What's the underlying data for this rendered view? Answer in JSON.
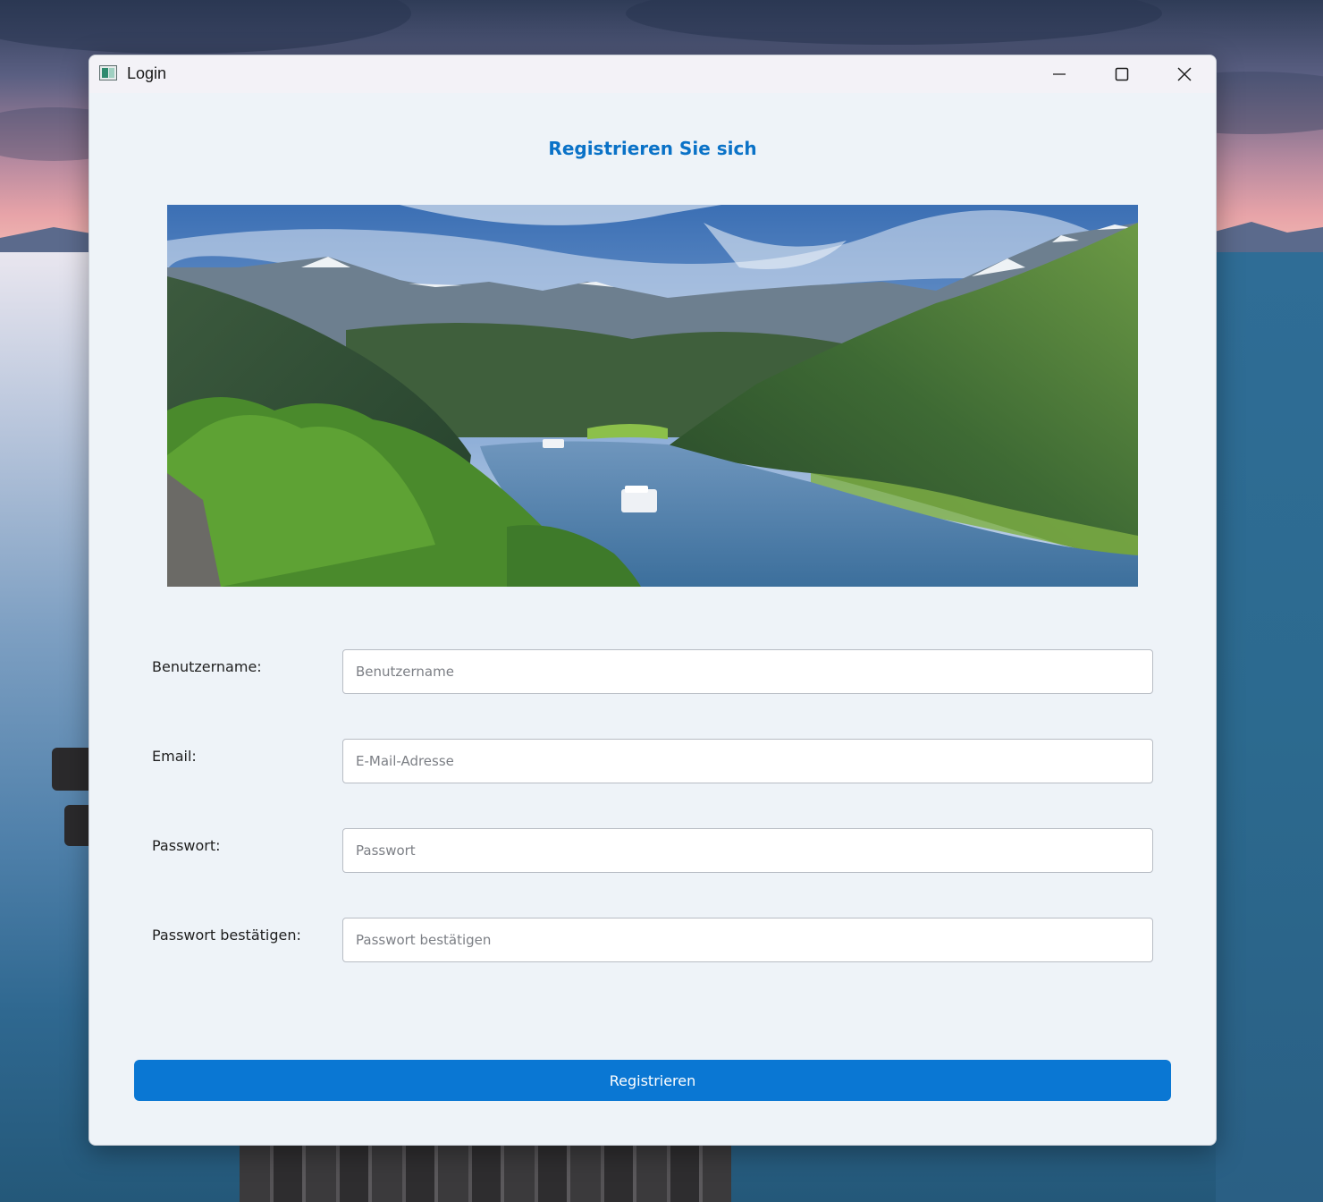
{
  "window": {
    "title": "Login",
    "controls": {
      "minimize": "minimize-icon",
      "maximize": "maximize-icon",
      "close": "close-icon"
    }
  },
  "form": {
    "heading": "Registrieren Sie sich",
    "fields": [
      {
        "label": "Benutzername:",
        "placeholder": "Benutzername",
        "value": ""
      },
      {
        "label": "Email:",
        "placeholder": "E-Mail-Adresse",
        "value": ""
      },
      {
        "label": "Passwort:",
        "placeholder": "Passwort",
        "value": ""
      },
      {
        "label": "Passwort bestätigen:",
        "placeholder": "Passwort bestätigen",
        "value": ""
      }
    ],
    "submit_label": "Registrieren"
  },
  "colors": {
    "accent": "#0a77d3",
    "heading": "#0a72c7",
    "window_bg": "#eef3f8"
  }
}
